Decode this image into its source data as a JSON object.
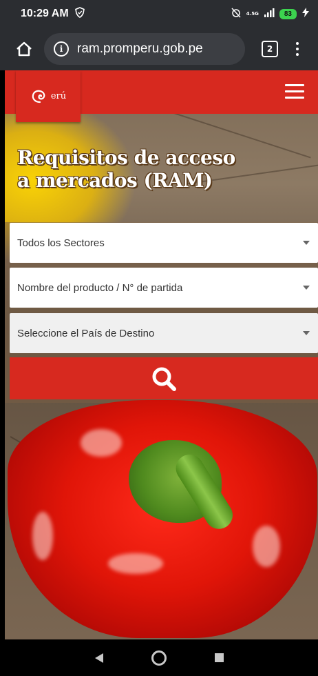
{
  "status_bar": {
    "time": "10:29 AM",
    "network_label": "4.5G",
    "battery_level": "83"
  },
  "browser": {
    "url": "ram.promperu.gob.pe",
    "tab_count": "2"
  },
  "site": {
    "logo_text": "erú",
    "hero_title": "Requisitos de acceso a mercados (RAM)",
    "brand_color": "#d7291f"
  },
  "filters": {
    "sector": "Todos los Sectores",
    "product": "Nombre del producto / N° de partida",
    "country": "Seleccione el País de Destino"
  }
}
